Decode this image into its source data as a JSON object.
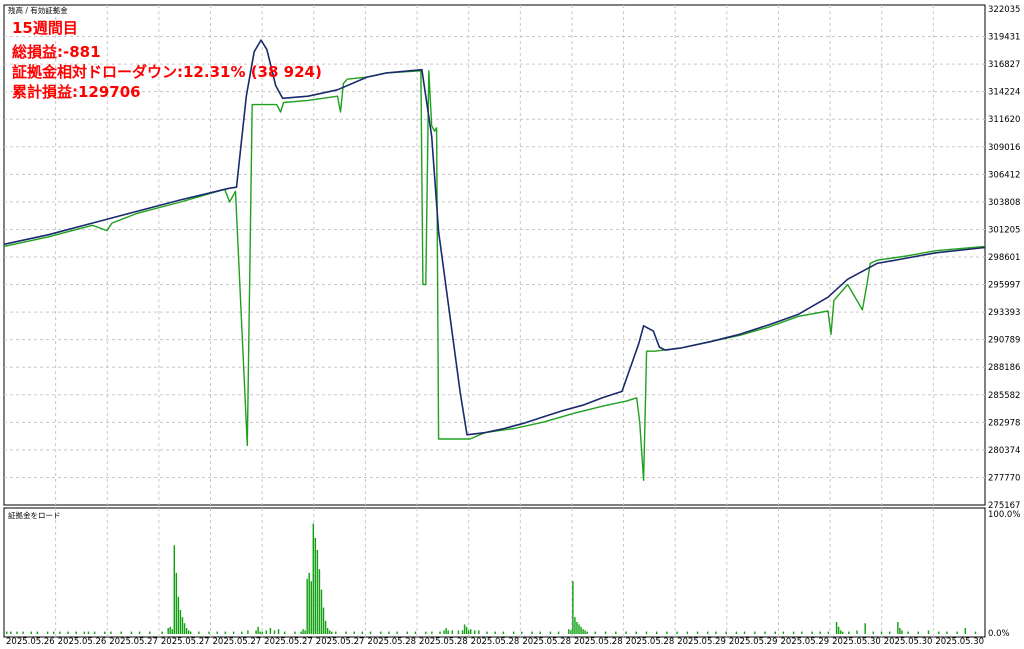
{
  "overlay": {
    "week": "15週間目",
    "total_pl": "総損益:-881",
    "drawdown": "証拠金相対ドローダウン:12.31% (38 924)",
    "cumulative": "累計損益:129706"
  },
  "colors": {
    "balance": "#1a2a6c",
    "equity": "#1fa01f",
    "load_bar": "#10a010",
    "overlay_text": "#ff0000"
  },
  "chart_data": [
    {
      "type": "line",
      "legend_text": "残高 / 有効証拠金",
      "y_ticks": [
        322035,
        319431,
        316827,
        314224,
        311620,
        309016,
        306412,
        303808,
        301205,
        298601,
        295997,
        293393,
        290789,
        288186,
        285582,
        282978,
        280374,
        277770,
        275167
      ],
      "ylim": [
        275167,
        322035
      ],
      "x_tick_labels": [
        "2025.05.26",
        "2025.05.26",
        "2025.05.27",
        "2025.05.27",
        "2025.05.27",
        "2025.05.27",
        "2025.05.27",
        "2025.05.28",
        "2025.05.28",
        "2025.05.28",
        "2025.05.28",
        "2025.05.28",
        "2025.05.28",
        "2025.05.29",
        "2025.05.29",
        "2025.05.29",
        "2025.05.30",
        "2025.05.30",
        "2025.05.30"
      ],
      "x_range": [
        0,
        100
      ],
      "grid": true,
      "series": [
        {
          "key": "balance",
          "x": [
            0,
            4.5,
            9,
            13.5,
            18,
            23,
            23.7,
            24.7,
            25.5,
            26.2,
            26.8,
            27.7,
            28.4,
            31,
            34,
            37,
            39,
            42.6,
            43.6,
            44.3,
            46.5,
            47.2,
            49,
            51,
            53,
            55,
            57,
            59,
            61,
            63,
            64.7,
            65.2,
            66.2,
            66.8,
            67.4,
            69,
            72,
            75,
            78,
            81,
            84,
            86,
            89,
            92,
            95,
            100
          ],
          "y": [
            299800,
            300700,
            301800,
            302900,
            304000,
            305100,
            305200,
            313800,
            318000,
            319100,
            318200,
            314800,
            313600,
            313800,
            314400,
            315600,
            316000,
            316300,
            310000,
            301000,
            285800,
            281800,
            282000,
            282400,
            282900,
            283500,
            284100,
            284600,
            285300,
            285900,
            290400,
            292100,
            291600,
            290100,
            289800,
            290000,
            290600,
            291300,
            292200,
            293200,
            294800,
            296500,
            298000,
            298500,
            299000,
            299500
          ]
        },
        {
          "key": "equity",
          "x": [
            0,
            4.5,
            9,
            10.5,
            11,
            13.5,
            18,
            22.5,
            23,
            23.6,
            24.8,
            25.3,
            26,
            27.8,
            28.2,
            28.5,
            31,
            34,
            34.3,
            34.6,
            35,
            37,
            39,
            42.5,
            42.7,
            43,
            43.3,
            43.6,
            43.9,
            44.1,
            44.3,
            46,
            47.5,
            49,
            52,
            55,
            58,
            61,
            63.5,
            64.5,
            64.8,
            65.2,
            65.5,
            66.3,
            69,
            72,
            75,
            78,
            81,
            84,
            84.3,
            84.6,
            86,
            87.5,
            88,
            88.3,
            89,
            92,
            95,
            100
          ],
          "y": [
            299600,
            300500,
            301600,
            301100,
            301800,
            302700,
            303800,
            305000,
            303800,
            304800,
            280800,
            313000,
            313000,
            313000,
            312300,
            313200,
            313400,
            313800,
            312300,
            315000,
            315400,
            315600,
            316000,
            316200,
            296000,
            296000,
            316200,
            311000,
            310500,
            310800,
            281400,
            281400,
            281400,
            282000,
            282400,
            283000,
            283800,
            284500,
            285000,
            285300,
            283000,
            277500,
            289700,
            289700,
            290000,
            290600,
            291200,
            292000,
            293000,
            293500,
            291300,
            294500,
            296000,
            293600,
            296200,
            298000,
            298300,
            298700,
            299200,
            299600
          ]
        }
      ]
    },
    {
      "type": "bar",
      "legend_text": "証拠金をロード",
      "y_ticks": [
        "100.0%",
        "0.0%"
      ],
      "ylim": [
        0,
        100
      ],
      "values": [
        2,
        0,
        2,
        0,
        0,
        2,
        0,
        0,
        2,
        0,
        0,
        0,
        2,
        0,
        0,
        2,
        0,
        0,
        0,
        0,
        2,
        0,
        0,
        2,
        0,
        0,
        2,
        0,
        0,
        0,
        2,
        0,
        0,
        0,
        2,
        0,
        0,
        0,
        2,
        0,
        2,
        0,
        0,
        2,
        0,
        0,
        0,
        0,
        2,
        0,
        0,
        2,
        0,
        0,
        0,
        0,
        2,
        0,
        0,
        0,
        0,
        2,
        0,
        0,
        0,
        2,
        0,
        0,
        0,
        0,
        2,
        0,
        0,
        0,
        0,
        0,
        2,
        0,
        0,
        5,
        6,
        4,
        74,
        51,
        31,
        20,
        14,
        9,
        5,
        3,
        2,
        0,
        0,
        0,
        2,
        0,
        0,
        0,
        0,
        2,
        0,
        0,
        0,
        2,
        0,
        0,
        0,
        2,
        0,
        0,
        0,
        2,
        0,
        0,
        0,
        2,
        0,
        0,
        3,
        0,
        0,
        0,
        3,
        6,
        2,
        2,
        0,
        3,
        0,
        5,
        0,
        3,
        0,
        4,
        0,
        0,
        2,
        0,
        0,
        0,
        0,
        2,
        0,
        0,
        2,
        4,
        3,
        46,
        51,
        44,
        92,
        80,
        70,
        54,
        37,
        22,
        11,
        5,
        3,
        2,
        0,
        2,
        0,
        0,
        0,
        0,
        2,
        0,
        0,
        0,
        2,
        0,
        0,
        0,
        2,
        0,
        0,
        0,
        2,
        0,
        0,
        0,
        0,
        2,
        0,
        0,
        0,
        2,
        0,
        0,
        0,
        2,
        0,
        0,
        0,
        0,
        2,
        0,
        0,
        0,
        2,
        0,
        0,
        0,
        0,
        2,
        0,
        0,
        2,
        0,
        0,
        0,
        2,
        0,
        3,
        5,
        3,
        0,
        3,
        0,
        0,
        3,
        0,
        3,
        8,
        6,
        3,
        4,
        0,
        3,
        0,
        3,
        0,
        0,
        0,
        2,
        0,
        0,
        0,
        2,
        0,
        0,
        0,
        2,
        0,
        0,
        0,
        0,
        2,
        0,
        0,
        0,
        2,
        0,
        0,
        0,
        0,
        2,
        0,
        0,
        0,
        2,
        0,
        0,
        0,
        0,
        2,
        0,
        0,
        0,
        2,
        0,
        0,
        0,
        0,
        4,
        3,
        44,
        14,
        10,
        8,
        6,
        4,
        3,
        2,
        0,
        0,
        0,
        2,
        0,
        0,
        0,
        0,
        2,
        0,
        0,
        0,
        0,
        2,
        0,
        0,
        0,
        0,
        2,
        0,
        0,
        0,
        0,
        2,
        0,
        0,
        0,
        0,
        2,
        0,
        0,
        0,
        0,
        2,
        0,
        0,
        0,
        0,
        2,
        0,
        0,
        0,
        0,
        2,
        0,
        0,
        0,
        0,
        2,
        0,
        0,
        0,
        0,
        2,
        0,
        0,
        0,
        0,
        2,
        0,
        0,
        0,
        2,
        0,
        0,
        0,
        0,
        2,
        0,
        0,
        0,
        0,
        2,
        0,
        0,
        0,
        2,
        0,
        0,
        0,
        0,
        2,
        0,
        0,
        0,
        0,
        2,
        0,
        0,
        0,
        0,
        2,
        0,
        0,
        0,
        2,
        0,
        0,
        0,
        0,
        2,
        0,
        0,
        0,
        2,
        0,
        0,
        0,
        0,
        2,
        0,
        0,
        0,
        2,
        0,
        0,
        0,
        2,
        0,
        0,
        0,
        10,
        6,
        3,
        2,
        0,
        0,
        2,
        0,
        0,
        0,
        3,
        0,
        0,
        0,
        9,
        0,
        0,
        0,
        2,
        0,
        0,
        0,
        2,
        0,
        0,
        0,
        2,
        0,
        0,
        0,
        10,
        5,
        3,
        0,
        0,
        2,
        0,
        0,
        0,
        0,
        2,
        0,
        0,
        0,
        0,
        3,
        0,
        0,
        0,
        0,
        2,
        0,
        0,
        0,
        2,
        0,
        0,
        0,
        0,
        2,
        0,
        0,
        0,
        5,
        0,
        0,
        0,
        0,
        2,
        0,
        0,
        0
      ]
    }
  ]
}
